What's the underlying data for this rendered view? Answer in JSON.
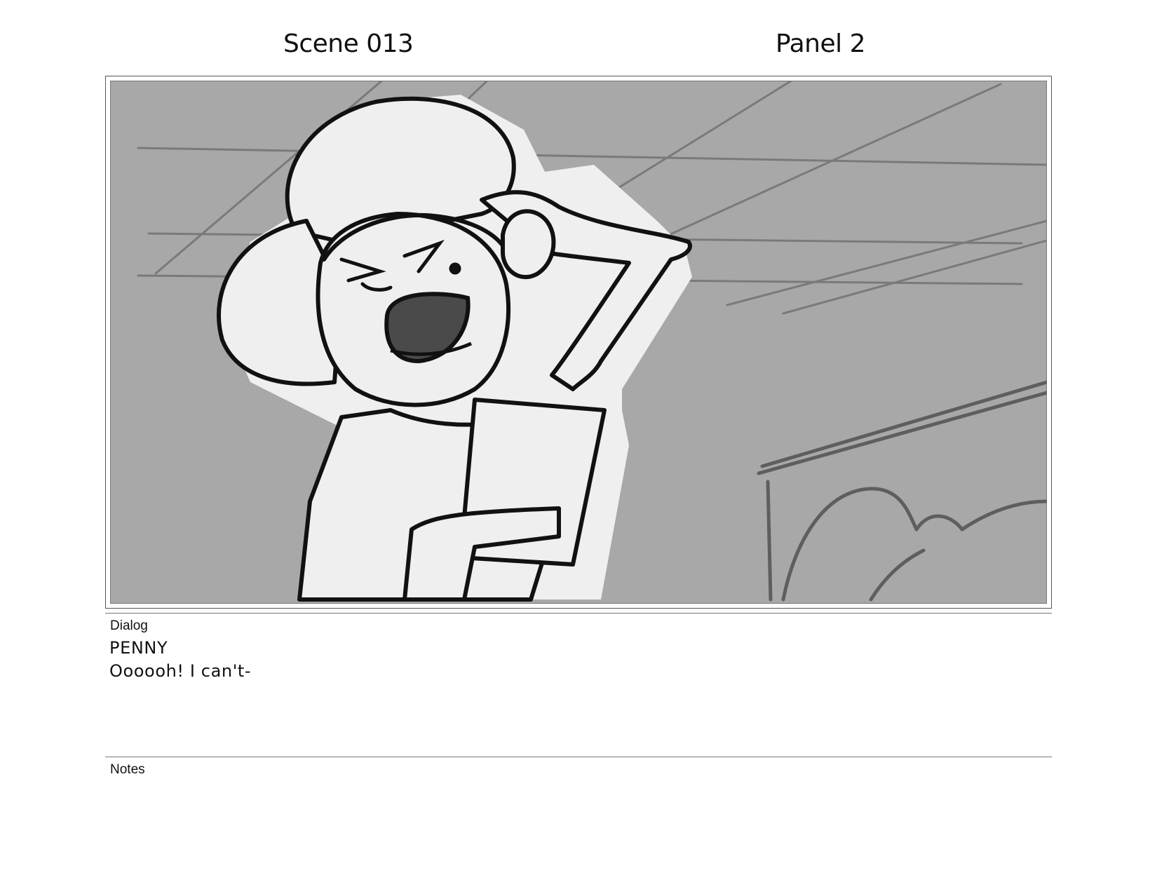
{
  "header": {
    "scene": "Scene 013",
    "panel": "Panel 2"
  },
  "panel_image": {
    "description_icon": "storyboard-sketch",
    "colors": {
      "background": "#a8a8a8",
      "figure_fill": "#efefef",
      "line": "#111111",
      "shadow": "#666666"
    }
  },
  "dialog": {
    "label": "Dialog",
    "character": "PENNY",
    "line": "Oooooh! I can't-"
  },
  "notes": {
    "label": "Notes"
  }
}
